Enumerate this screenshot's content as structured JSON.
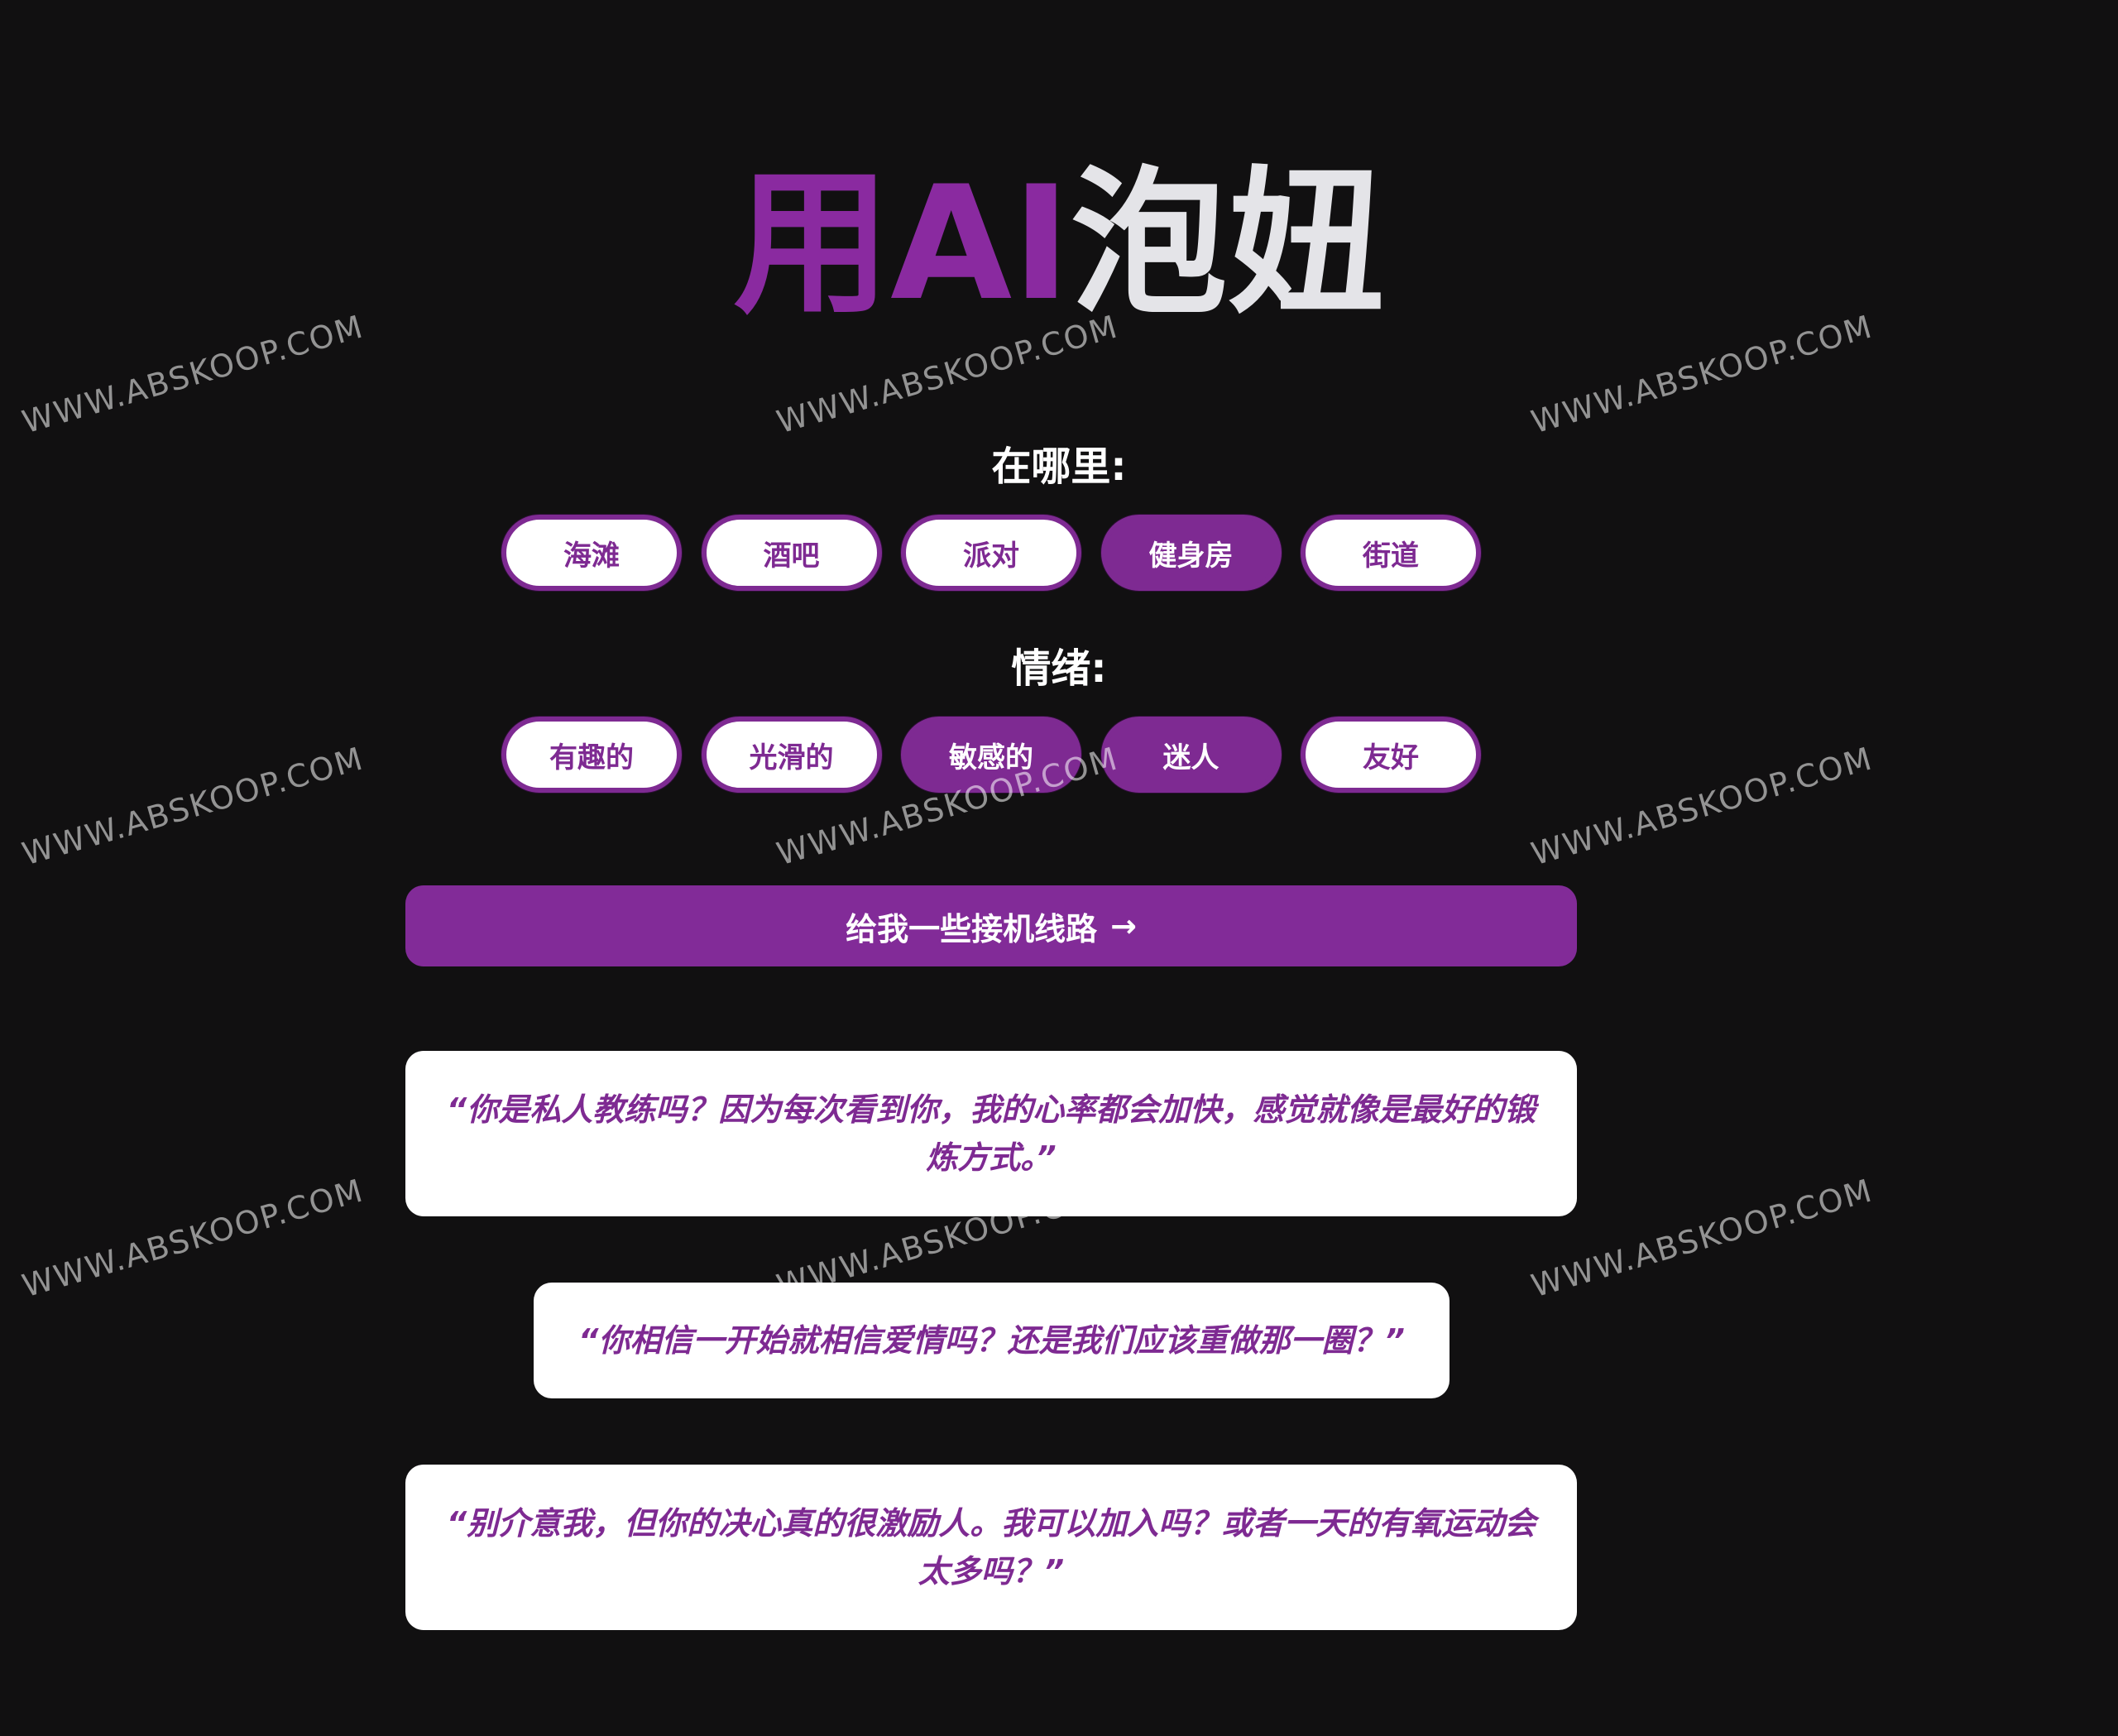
{
  "header": {
    "title_part1": "用AI",
    "title_part2": "泡妞"
  },
  "where": {
    "label": "在哪里:",
    "options": [
      "海滩",
      "酒吧",
      "派对",
      "健身房",
      "街道"
    ],
    "selected": "健身房"
  },
  "mood": {
    "label": "情绪:",
    "options": [
      "有趣的",
      "光滑的",
      "敏感的",
      "迷人",
      "友好"
    ],
    "selected": [
      "敏感的",
      "迷人"
    ]
  },
  "cta": {
    "label": "给我一些接机线路",
    "arrow": "→"
  },
  "results": [
    "“你是私人教练吗？因为每次看到你，我的心率都会加快，感觉就像是最好的锻炼方式。”",
    "“你相信一开始就相信爱情吗？还是我们应该重做那一圈？”",
    "“别介意我，但你的决心真的很激励人。我可以加入吗？或者一天的有氧运动会太多吗？”"
  ],
  "watermark": {
    "text": "WWW.ABSKOOP.COM",
    "top_fragment": "WWW."
  },
  "colors": {
    "background": "#111011",
    "accent": "#822b98",
    "title_light": "#e4e4e8",
    "card_bg": "#ffffff"
  }
}
